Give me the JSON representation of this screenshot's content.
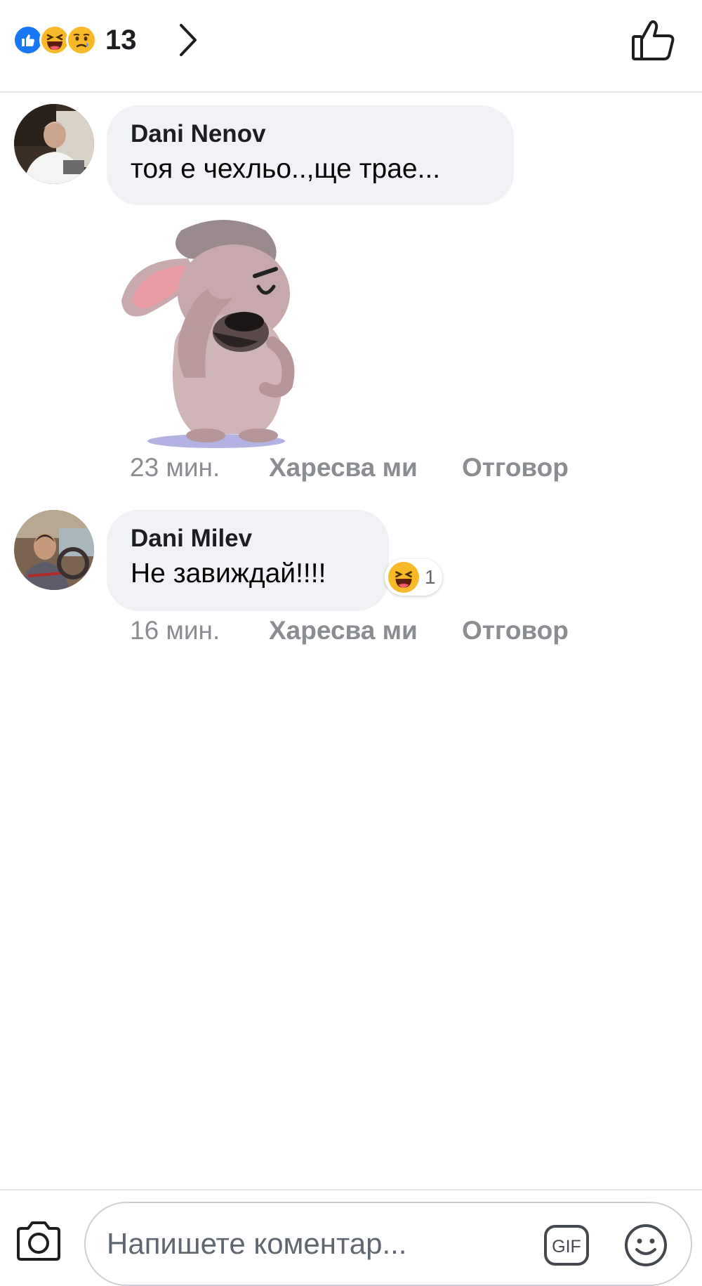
{
  "header": {
    "reaction_icons": [
      "like-icon",
      "haha-icon",
      "sad-icon"
    ],
    "reaction_count": "13",
    "chevron_icon": "chevron-right-icon",
    "like_icon": "thumbs-up-outline-icon"
  },
  "comments": [
    {
      "name": "Dani Nenov",
      "text": "тоя е чехльо..,ще трае...",
      "has_sticker": true,
      "time": "23 мин.",
      "like_label": "Харесва ми",
      "reply_label": "Отговор"
    },
    {
      "name": "Dani Milev",
      "text": "Не завиждай!!!!",
      "reaction": {
        "icon": "haha-icon",
        "count": "1"
      },
      "time": "16 мин.",
      "like_label": "Харесва ми",
      "reply_label": "Отговор"
    }
  ],
  "composer": {
    "placeholder": "Напишете коментар...",
    "gif_label": "GIF",
    "camera_icon": "camera-icon",
    "emoji_icon": "smiley-icon"
  },
  "colors": {
    "accent": "#1877f2",
    "bubble": "#f0f2f5",
    "meta_text": "#8a8d91",
    "haha_yellow": "#f7b928"
  }
}
